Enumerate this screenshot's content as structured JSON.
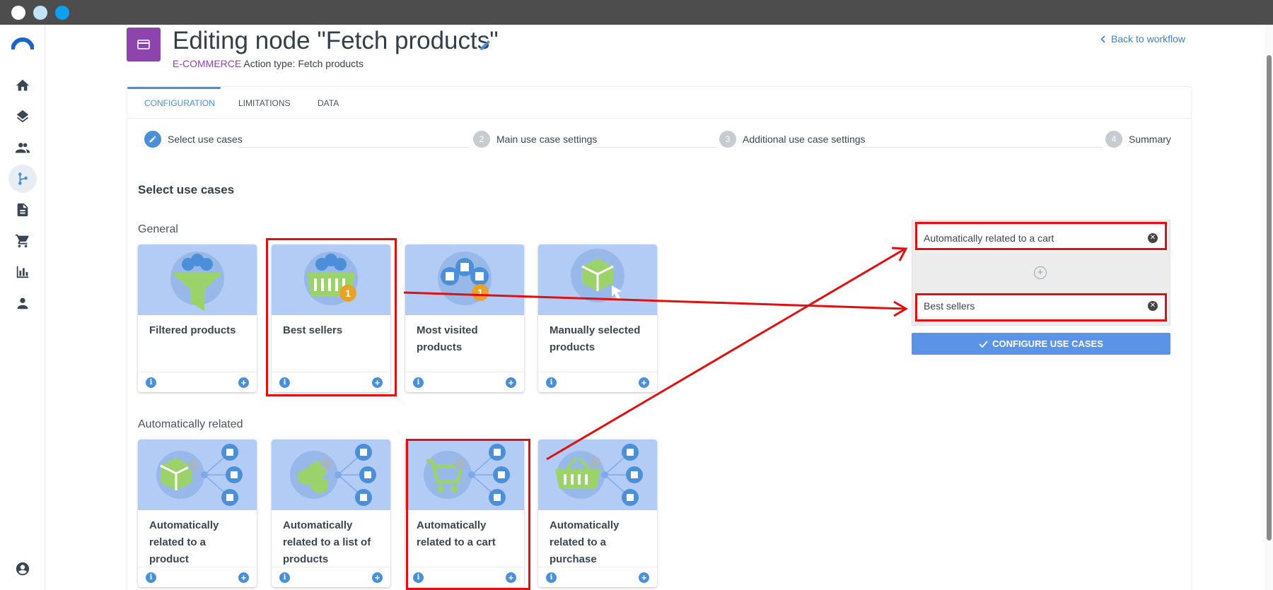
{
  "header": {
    "title": "Editing node \"Fetch products\"",
    "category": "E-COMMERCE",
    "action_type": "Action type: Fetch products",
    "back_link": "Back to workflow"
  },
  "tabs": [
    {
      "label": "CONFIGURATION",
      "active": true
    },
    {
      "label": "LIMITATIONS",
      "active": false
    },
    {
      "label": "DATA",
      "active": false
    }
  ],
  "steps": [
    {
      "number": "",
      "label": "Select use cases",
      "active": true
    },
    {
      "number": "2",
      "label": "Main use case settings",
      "active": false
    },
    {
      "number": "3",
      "label": "Additional use case settings",
      "active": false
    },
    {
      "number": "4",
      "label": "Summary",
      "active": false
    }
  ],
  "section_title": "Select use cases",
  "groups": [
    {
      "title": "General",
      "cards": [
        {
          "label": "Filtered products",
          "icon": "funnel-icon"
        },
        {
          "label": "Best sellers",
          "icon": "basket-medal-icon",
          "highlighted": true
        },
        {
          "label": "Most visited products",
          "icon": "boxes-medal-icon"
        },
        {
          "label": "Manually selected products",
          "icon": "box-cursor-icon"
        }
      ]
    },
    {
      "title": "Automatically related",
      "cards": [
        {
          "label": "Automatically related to a product",
          "icon": "box-network-icon"
        },
        {
          "label": "Automatically related to a list of products",
          "icon": "boxes-network-icon"
        },
        {
          "label": "Automatically related to a cart",
          "icon": "cart-network-icon",
          "highlighted": true
        },
        {
          "label": "Automatically related to a purchase",
          "icon": "basket-network-icon"
        }
      ]
    }
  ],
  "selected": [
    {
      "label": "Automatically related to a cart"
    },
    {
      "label": "Best sellers"
    }
  ],
  "configure_button": "CONFIGURE USE CASES",
  "colors": {
    "accent": "#4a8fd8",
    "node_icon": "#8e44ad",
    "highlight": "#e01010",
    "card_image": "#b3ccf5",
    "illustration_green": "#9bd36a"
  },
  "sidebar_icons": [
    "home-icon",
    "layers-icon",
    "people-icon",
    "workflow-icon",
    "document-icon",
    "cart-icon",
    "bar-chart-icon",
    "person-icon",
    "account-icon"
  ]
}
